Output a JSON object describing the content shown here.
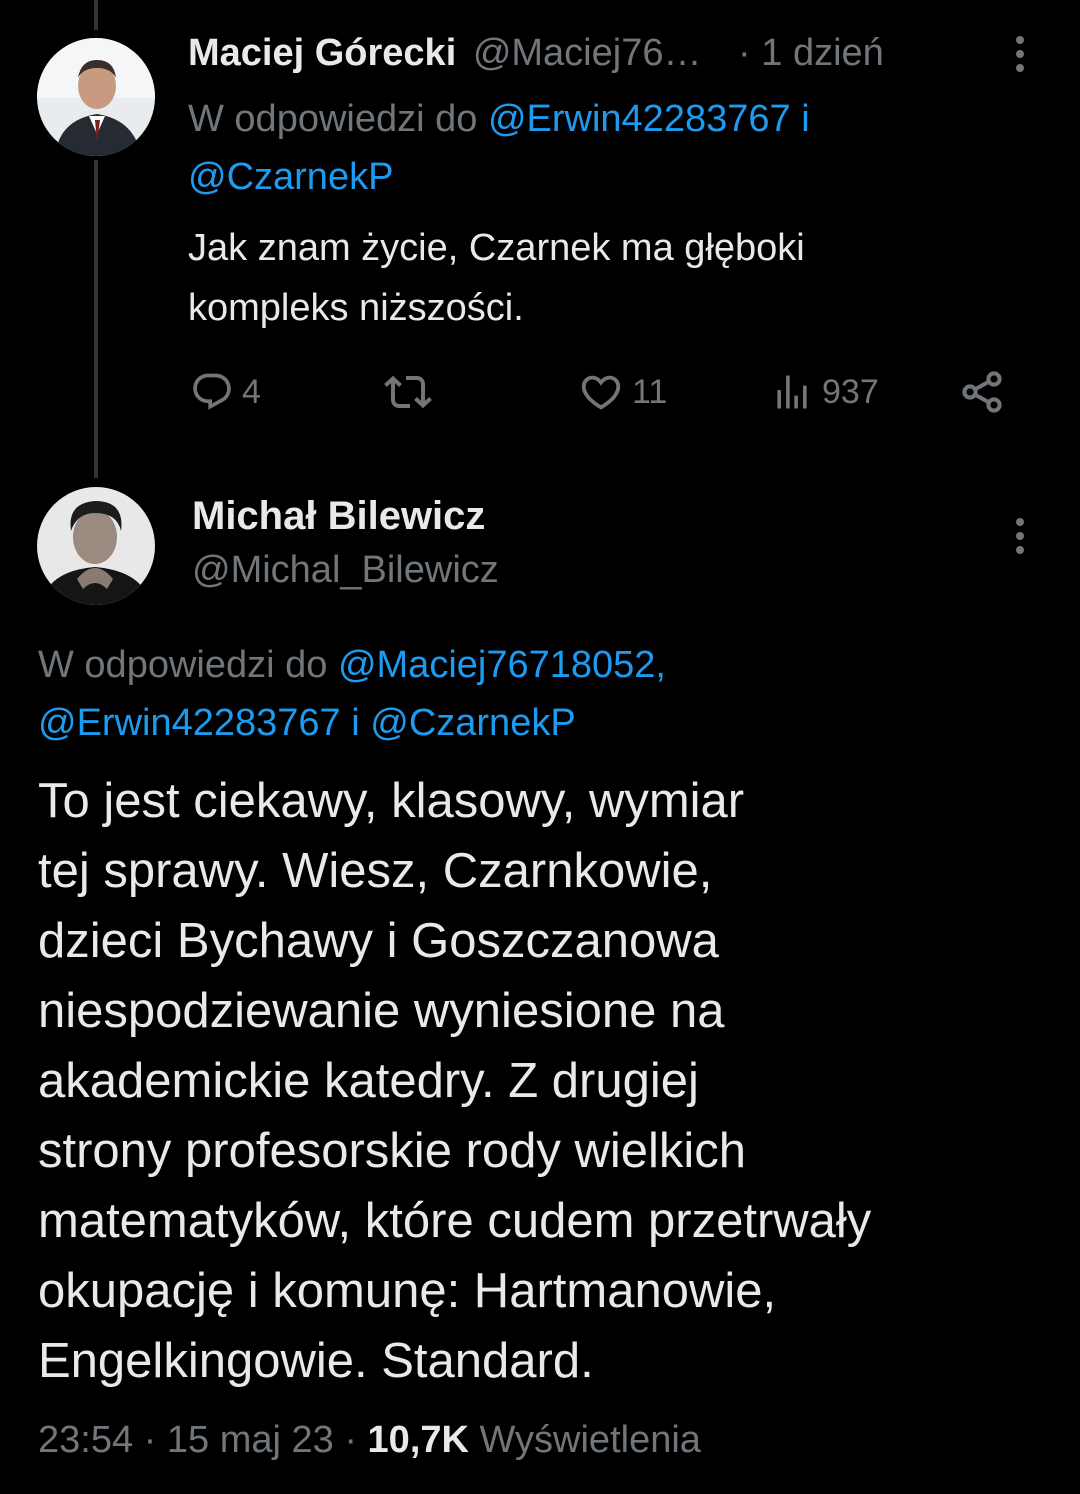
{
  "colors": {
    "background": "#000000",
    "text_primary": "#e7e9ea",
    "text_secondary": "#71767b",
    "link": "#1d9bf0",
    "thread_line": "#333639"
  },
  "reply_tweet": {
    "author_name": "Maciej Górecki",
    "author_handle": "@Maciej76…",
    "separator": "·",
    "time": "1 dzień",
    "replying_prefix": "W odpowiedzi do",
    "replying_handle_1": "@Erwin42283767",
    "replying_conjunction": "i",
    "replying_handle_2": "@CzarnekP",
    "text_lines": [
      "Jak znam życie, Czarnek ma głęboki",
      "kompleks niższości."
    ],
    "actions": {
      "reply_count": "4",
      "retweet_count": "",
      "like_count": "11",
      "views_count": "937"
    },
    "icons": [
      "more-icon",
      "reply-icon",
      "retweet-icon",
      "like-icon",
      "views-icon",
      "share-icon"
    ]
  },
  "main_tweet": {
    "author_name": "Michał Bilewicz",
    "author_handle": "@Michal_Bilewicz",
    "replying_prefix": "W odpowiedzi do",
    "replying_handle_1": "@Maciej76718052,",
    "replying_handle_2": "@Erwin42283767",
    "replying_conjunction": "i",
    "replying_handle_3": "@CzarnekP",
    "text_lines": [
      "To jest ciekawy, klasowy, wymiar",
      "tej sprawy. Wiesz, Czarnkowie,",
      "dzieci Bychawy i Goszczanowa",
      "niespodziewanie wyniesione na",
      "akademickie katedry. Z drugiej",
      "strony profesorskie rody wielkich",
      "matematyków, które cudem przetrwały",
      "okupację i komunę: Hartmanowie,",
      "Engelkingowie. Standard."
    ],
    "time": "23:54",
    "date": "15 maj 23",
    "separator": "·",
    "views_count": "10,7K",
    "views_label": "Wyświetlenia"
  }
}
